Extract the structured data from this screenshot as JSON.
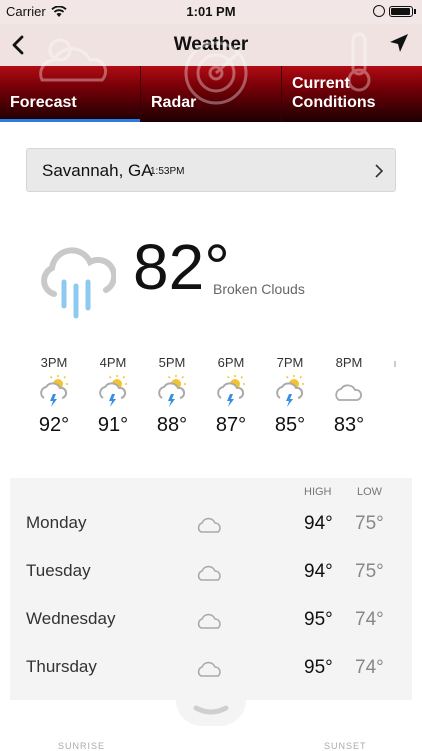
{
  "status": {
    "carrier": "Carrier",
    "time": "1:01 PM"
  },
  "nav": {
    "title": "Weather",
    "back_icon": "chevron-left-icon",
    "locate_icon": "location-arrow-icon"
  },
  "tabs": [
    {
      "label": "Forecast",
      "active": true
    },
    {
      "label": "Radar",
      "active": false
    },
    {
      "label": "Current\nConditions",
      "label_line1": "Current",
      "label_line2": "Conditions",
      "active": false
    }
  ],
  "location": {
    "city": "Savannah, GA",
    "time": "1:53PM"
  },
  "current": {
    "temp": "82°",
    "condition": "Broken Clouds",
    "icon": "rain-cloud-icon"
  },
  "hourly": [
    {
      "time": "3PM",
      "temp": "92°",
      "icon": "thunderstorm-sun-icon"
    },
    {
      "time": "4PM",
      "temp": "91°",
      "icon": "thunderstorm-sun-icon"
    },
    {
      "time": "5PM",
      "temp": "88°",
      "icon": "thunderstorm-sun-icon"
    },
    {
      "time": "6PM",
      "temp": "87°",
      "icon": "thunderstorm-sun-icon"
    },
    {
      "time": "7PM",
      "temp": "85°",
      "icon": "thunderstorm-sun-icon"
    },
    {
      "time": "8PM",
      "temp": "83°",
      "icon": "cloud-icon"
    }
  ],
  "daily": {
    "high_label": "HIGH",
    "low_label": "LOW",
    "days": [
      {
        "name": "Monday",
        "high": "94°",
        "low": "75°",
        "icon": "cloud-icon"
      },
      {
        "name": "Tuesday",
        "high": "94°",
        "low": "75°",
        "icon": "cloud-icon"
      },
      {
        "name": "Wednesday",
        "high": "95°",
        "low": "74°",
        "icon": "cloud-icon"
      },
      {
        "name": "Thursday",
        "high": "95°",
        "low": "74°",
        "icon": "cloud-icon"
      }
    ]
  },
  "sun": {
    "sunrise_label": "SUNRISE",
    "sunset_label": "SUNSET"
  },
  "colors": {
    "accent": "#2c7be5",
    "tab_red": "#b20c14",
    "rain_blue": "#8ec9f0",
    "sun_yellow": "#f4c430",
    "bolt_blue": "#3a8fe0"
  }
}
